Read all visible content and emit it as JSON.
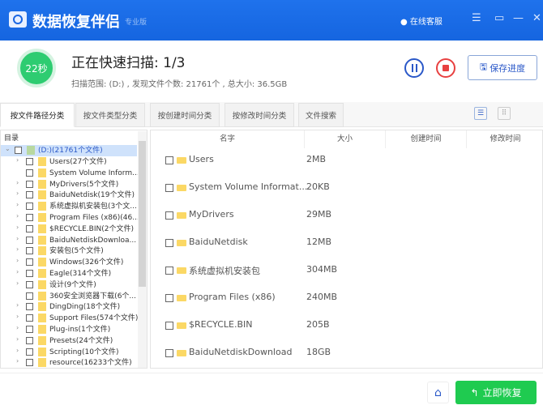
{
  "titlebar": {
    "app_name": "数据恢复伴侣",
    "edition": "专业版",
    "support": "在线客服",
    "menu": "☰",
    "maximize": "▭",
    "minimize": "—",
    "close": "✕"
  },
  "scan": {
    "timer": "22秒",
    "title": "正在快速扫描:   1/3",
    "info": "扫描范围: (D:) , 发现文件个数: 21761个 , 总大小: 36.5GB",
    "save_label": "保存进度"
  },
  "tabs": [
    "按文件路径分类",
    "按文件类型分类",
    "按创建时间分类",
    "按修改时间分类",
    "文件搜索"
  ],
  "tree": {
    "header": "目录",
    "root": "(D:)(21761个文件)",
    "items": [
      {
        "label": "Users(27个文件)",
        "expand": true
      },
      {
        "label": "System Volume Inform...",
        "expand": false
      },
      {
        "label": "MyDrivers(5个文件)",
        "expand": true
      },
      {
        "label": "BaiduNetdisk(19个文件)",
        "expand": true
      },
      {
        "label": "系统虚拟机安装包(3个文...",
        "expand": true
      },
      {
        "label": "Program Files (x86)(46...",
        "expand": true
      },
      {
        "label": "$RECYCLE.BIN(2个文件)",
        "expand": true
      },
      {
        "label": "BaiduNetdiskDownloa...",
        "expand": true
      },
      {
        "label": "安装包(5个文件)",
        "expand": true
      },
      {
        "label": "Windows(326个文件)",
        "expand": true
      },
      {
        "label": "Eagle(314个文件)",
        "expand": true
      },
      {
        "label": "设计(9个文件)",
        "expand": true
      },
      {
        "label": "360安全浏览器下载(6个...",
        "expand": false
      },
      {
        "label": "DingDing(18个文件)",
        "expand": true
      },
      {
        "label": "Support Files(574个文件)",
        "expand": true
      },
      {
        "label": "Plug-ins(1个文件)",
        "expand": true
      },
      {
        "label": "Presets(24个文件)",
        "expand": true
      },
      {
        "label": "Scripting(10个文件)",
        "expand": true
      },
      {
        "label": "resource(16233个文件)",
        "expand": true
      }
    ]
  },
  "table": {
    "columns": [
      "名字",
      "大小",
      "创建时间",
      "修改时间"
    ],
    "rows": [
      {
        "name": "Users",
        "size": "2MB"
      },
      {
        "name": "System Volume Informat...",
        "size": "20KB"
      },
      {
        "name": "MyDrivers",
        "size": "29MB"
      },
      {
        "name": "BaiduNetdisk",
        "size": "12MB"
      },
      {
        "name": "系统虚拟机安装包",
        "size": "304MB"
      },
      {
        "name": "Program Files (x86)",
        "size": "240MB"
      },
      {
        "name": "$RECYCLE.BIN",
        "size": "205B"
      },
      {
        "name": "BaiduNetdiskDownload",
        "size": "18GB"
      }
    ]
  },
  "footer": {
    "recover_label": "立即恢复"
  },
  "colors": {
    "brand": "#1a6be8",
    "green": "#1fcb50",
    "stop": "#e84040"
  }
}
